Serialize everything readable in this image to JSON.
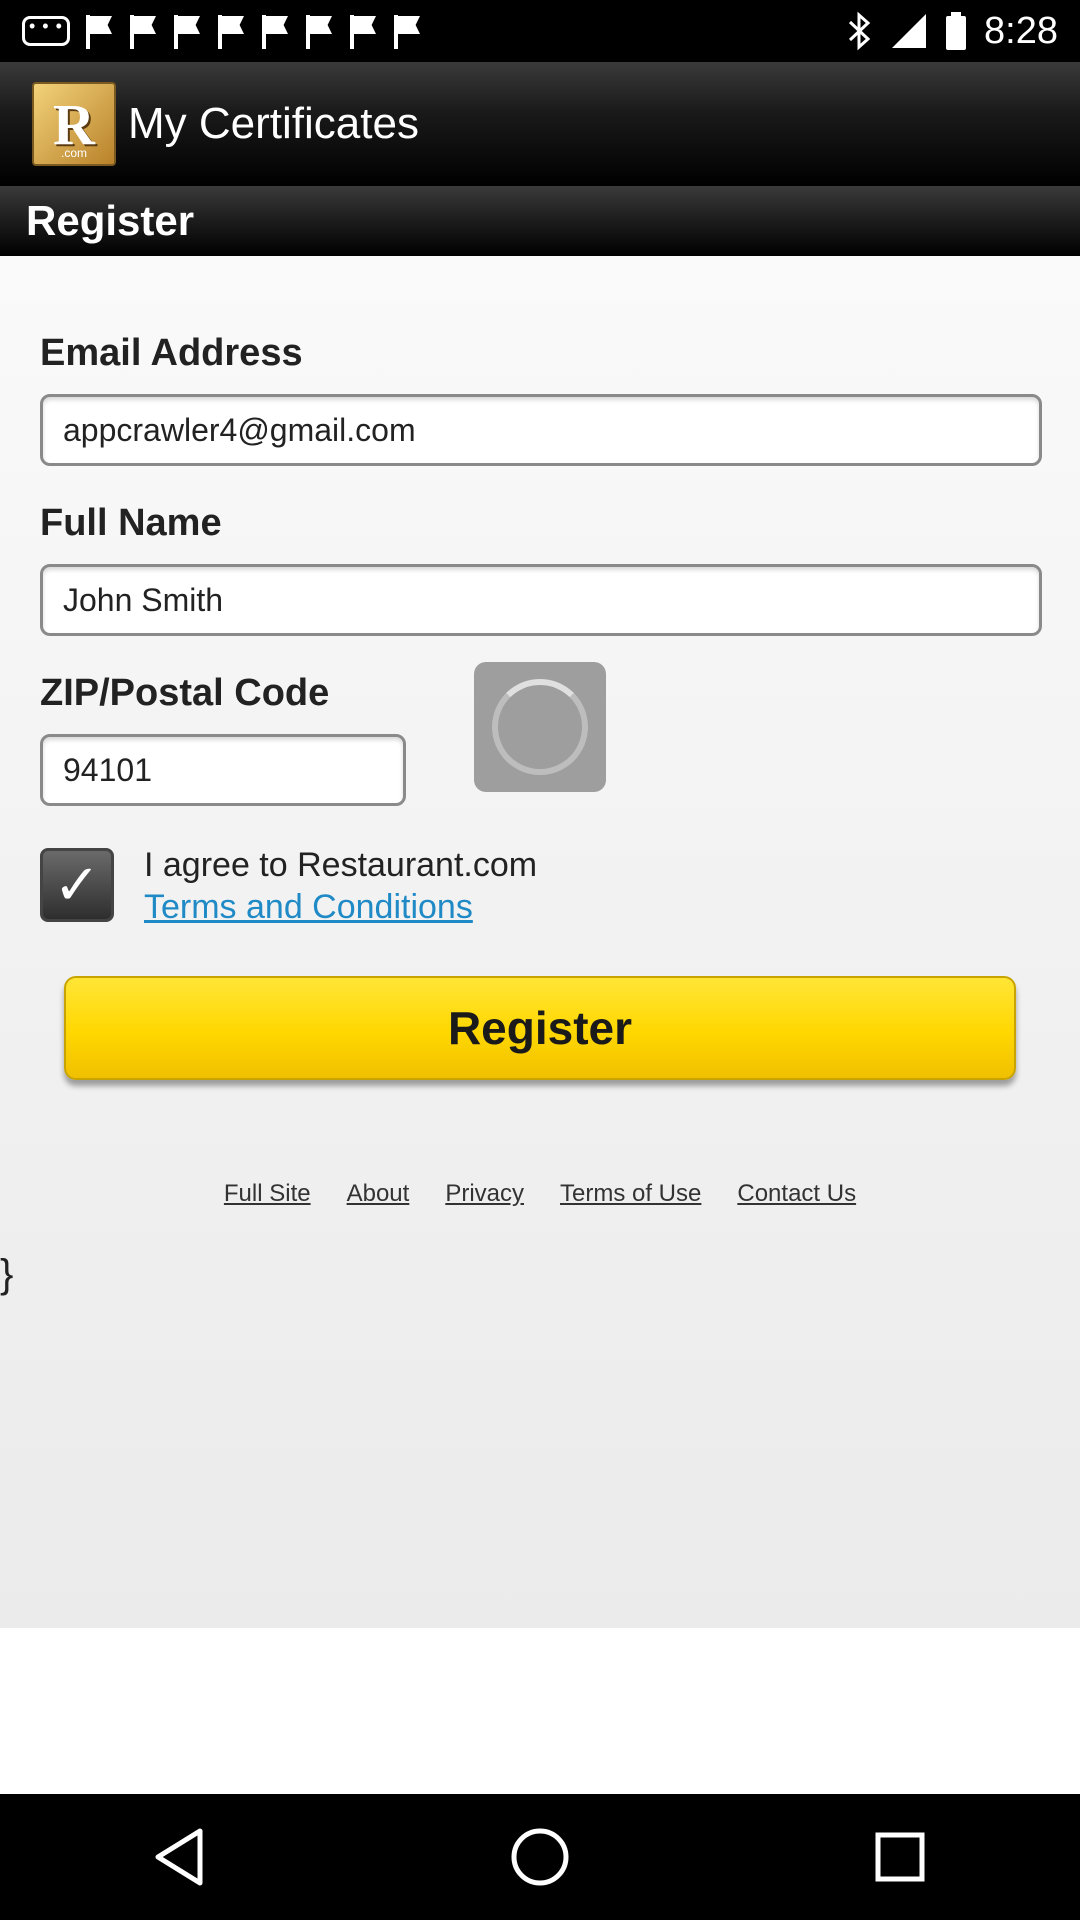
{
  "status_bar": {
    "time": "8:28",
    "left_icons": [
      "chat-icon",
      "flag-icon",
      "flag-icon",
      "flag-icon",
      "flag-icon",
      "flag-icon",
      "flag-icon",
      "flag-icon",
      "flag-icon"
    ],
    "right_icons": [
      "bluetooth-icon",
      "signal-icon",
      "battery-icon"
    ]
  },
  "app_bar": {
    "logo_letter": "R",
    "logo_suffix": ".com",
    "title": "My Certificates"
  },
  "section": {
    "title": "Register"
  },
  "form": {
    "email": {
      "label": "Email Address",
      "value": "appcrawler4@gmail.com"
    },
    "full_name": {
      "label": "Full Name",
      "value": "John Smith"
    },
    "zip": {
      "label": "ZIP/Postal Code",
      "value": "94101"
    },
    "agree": {
      "checked": true,
      "text": "I agree to Restaurant.com",
      "link": "Terms and Conditions"
    },
    "submit_label": "Register"
  },
  "footer": {
    "links": [
      "Full Site",
      "About",
      "Privacy",
      "Terms of Use",
      "Contact Us"
    ]
  },
  "stray_text": "}",
  "nav_bar": {
    "buttons": [
      "back-icon",
      "home-icon",
      "recents-icon"
    ]
  }
}
